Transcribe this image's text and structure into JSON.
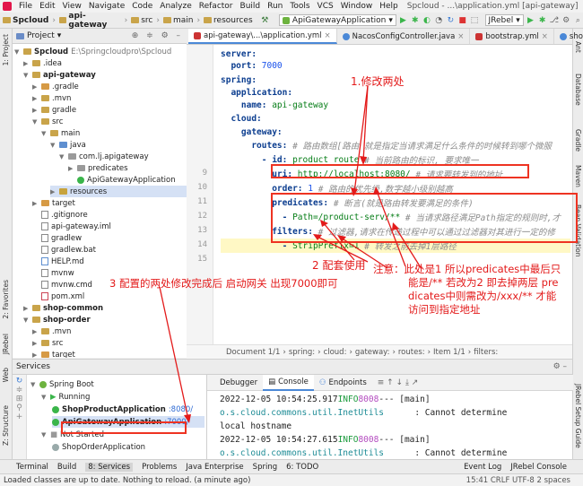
{
  "menu": [
    "File",
    "Edit",
    "View",
    "Navigate",
    "Code",
    "Analyze",
    "Refactor",
    "Build",
    "Run",
    "Tools",
    "VCS",
    "Window",
    "Help"
  ],
  "window_title": "Spcloud - ...\\application.yml [api-gateway]",
  "breadcrumb": [
    "Spcloud",
    "api-gateway",
    "src",
    "main",
    "resources"
  ],
  "run_config": "ApiGatewayApplication",
  "jrebel": "JRebel",
  "project": {
    "header": "Project",
    "root_path": "E:\\Springcloudpro\\Spcloud",
    "items": [
      {
        "label": "Spcloud",
        "extra": "E:\\Springcloudpro\\Spcloud"
      },
      {
        "label": ".idea"
      },
      {
        "label": "api-gateway"
      },
      {
        "label": ".gradle"
      },
      {
        "label": ".mvn"
      },
      {
        "label": "gradle"
      },
      {
        "label": "src"
      },
      {
        "label": "main"
      },
      {
        "label": "java"
      },
      {
        "label": "com.lj.apigateway"
      },
      {
        "label": "predicates"
      },
      {
        "label": "ApiGatewayApplication"
      },
      {
        "label": "resources"
      },
      {
        "label": "target"
      },
      {
        "label": ".gitignore"
      },
      {
        "label": "api-gateway.iml"
      },
      {
        "label": "gradlew"
      },
      {
        "label": "gradlew.bat"
      },
      {
        "label": "HELP.md"
      },
      {
        "label": "mvnw"
      },
      {
        "label": "mvnw.cmd"
      },
      {
        "label": "pom.xml"
      },
      {
        "label": "shop-common"
      },
      {
        "label": "shop-order"
      },
      {
        "label": ".mvn"
      },
      {
        "label": "src"
      },
      {
        "label": "target"
      }
    ]
  },
  "editor_tabs": [
    "api-gateway\\...\\application.yml",
    "NacosConfigController.java",
    "bootstrap.yml",
    "shop-"
  ],
  "code": {
    "lines": [
      {
        "n": "",
        "key": "server:",
        "val": "",
        "comment": ""
      },
      {
        "n": "",
        "key": "  port: ",
        "val": "7000",
        "comment": ""
      },
      {
        "n": "",
        "key": "spring:",
        "val": "",
        "comment": ""
      },
      {
        "n": "",
        "key": "  application:",
        "val": "",
        "comment": ""
      },
      {
        "n": "",
        "key": "    name: ",
        "val": "api-gateway",
        "comment": ""
      },
      {
        "n": "",
        "key": "  cloud:",
        "val": "",
        "comment": ""
      },
      {
        "n": "",
        "key": "    gateway:",
        "val": "",
        "comment": ""
      },
      {
        "n": "",
        "key": "      routes: ",
        "val": "",
        "comment": "# 路由数组[路由 就是指定当请求满足什么条件的时候转到哪个微服"
      },
      {
        "n": "9",
        "key": "        - id: ",
        "val": "product_route ",
        "comment": "# 当前路由的标识, 要求唯一"
      },
      {
        "n": "10",
        "key": "          uri: ",
        "val": "http://localhost:8080/ ",
        "comment": "# 请求要转发到的地址"
      },
      {
        "n": "11",
        "key": "          order: ",
        "val": "1 ",
        "comment": "# 路由的优先级,数字越小级别越高"
      },
      {
        "n": "12",
        "key": "          predicates: ",
        "val": "",
        "comment": "# 断言(就是路由转发要满足的条件)"
      },
      {
        "n": "13",
        "key": "            - ",
        "val": "Path=/product-serv/** ",
        "comment": "# 当请求路径满足Path指定的规则时,才"
      },
      {
        "n": "14",
        "key": "          filters: ",
        "val": "",
        "comment": "# 过滤器,请求在传递过程中可以通过过滤器对其进行一定的修"
      },
      {
        "n": "15",
        "key": "            - ",
        "val": "StripPrefix=1 ",
        "comment": "# 转发之前去掉1层路径"
      }
    ]
  },
  "editor_breadcrumb": [
    "Document 1/1",
    "spring:",
    "cloud:",
    "gateway:",
    "routes:",
    "Item 1/1",
    "filters:"
  ],
  "services": {
    "header": "Services",
    "tree": [
      {
        "label": "Spring Boot"
      },
      {
        "label": "Running"
      },
      {
        "label": "ShopProductApplication",
        "port": ":8080/"
      },
      {
        "label": "ApiGatewayApplication",
        "port": ":7000/"
      },
      {
        "label": "Not Started"
      },
      {
        "label": "ShopOrderApplication"
      }
    ]
  },
  "console": {
    "tabs": [
      "Debugger",
      "Console",
      "Endpoints"
    ],
    "lines": [
      {
        "ts": "2022-12-05 10:54:25.917",
        "level": "INFO",
        "pid": "8008",
        "sep": "--- [",
        "thread": "main]",
        "logger": "",
        "msg": ""
      },
      {
        "ts": "",
        "level": "",
        "pid": "",
        "sep": "",
        "thread": "",
        "logger": "o.s.cloud.commons.util.InetUtils",
        "msg": "      : Cannot determine"
      },
      {
        "ts": "",
        "level": "",
        "pid": "",
        "sep": "",
        "thread": "",
        "logger": "",
        "msg": "local hostname"
      },
      {
        "ts": "2022-12-05 10:54:27.615",
        "level": "INFO",
        "pid": "8008",
        "sep": "--- [",
        "thread": "main]",
        "logger": "",
        "msg": ""
      },
      {
        "ts": "",
        "level": "",
        "pid": "",
        "sep": "",
        "thread": "",
        "logger": "o.s.cloud.commons.util.InetUtils",
        "msg": "      : Cannot determine"
      }
    ]
  },
  "bottom_tabs": [
    "Terminal",
    "Build",
    "8: Services",
    "Problems",
    "Java Enterprise",
    "Spring",
    "6: TODO",
    "Event Log",
    "JRebel Console"
  ],
  "status": {
    "left": "Loaded classes are up to date. Nothing to reload. (a minute ago)",
    "right": "15:41  CRLF  UTF-8  2 spaces"
  },
  "left_strip": [
    "1: Project",
    "2: Favorites",
    "JRebel",
    "Web",
    "Z: Structure"
  ],
  "right_strip": [
    "Ant",
    "Database",
    "Gradle",
    "Maven",
    "Bean Validation",
    "JRebel Setup Guide"
  ],
  "annotations": {
    "a1": "1.修改两处",
    "a2": "2  配套使用",
    "a3": "3   配置的两处修改完成后 启动网关 出现7000即可",
    "note1": "注意：此处是1 所以predicates中最后只",
    "note2": "能是/** 若改为2 即去掉两层  pre",
    "note3": "dicates中则需改为/xxx/** 才能",
    "note4": "访问到指定地址"
  },
  "colors": {
    "annotation": "#e31a1a",
    "keyword": "#0b3d8f",
    "value": "#067d17",
    "comment": "#8c8c8c"
  }
}
